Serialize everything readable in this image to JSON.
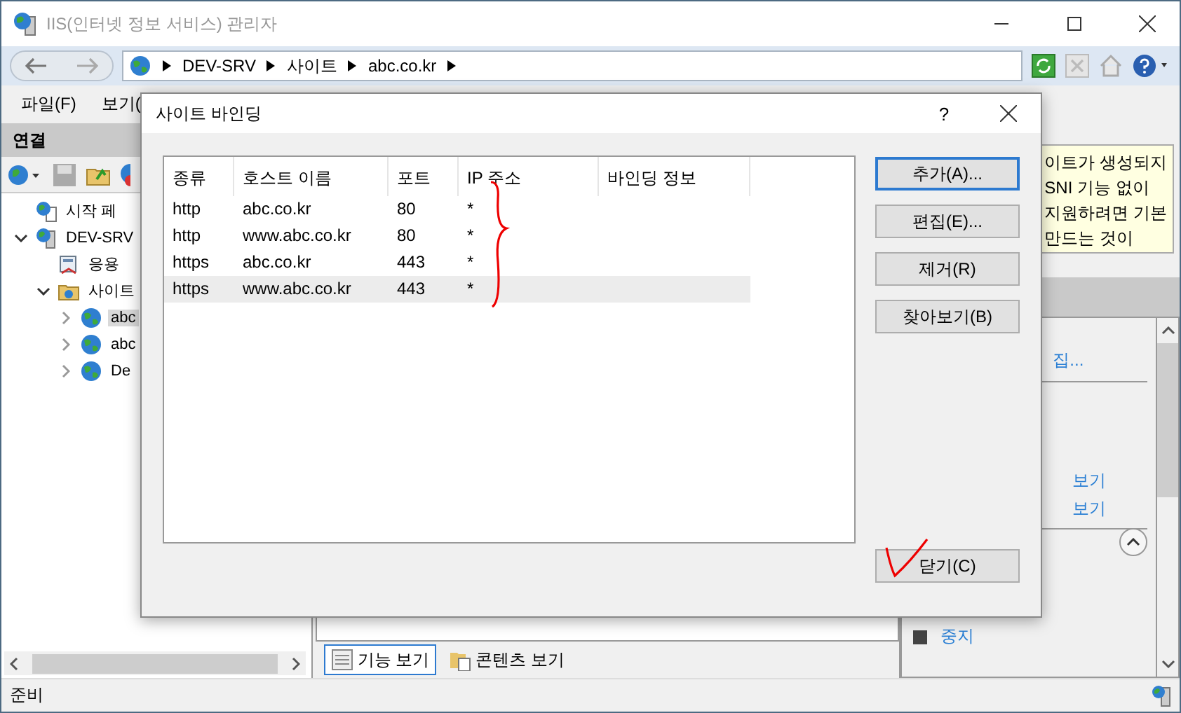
{
  "window": {
    "title": "IIS(인터넷 정보 서비스) 관리자"
  },
  "address_bar": {
    "crumbs": [
      "DEV-SRV",
      "사이트",
      "abc.co.kr"
    ]
  },
  "menu": [
    "파일(F)",
    "보기("
  ],
  "connections": {
    "title": "연결",
    "tree": [
      {
        "label": "시작 페",
        "kind": "page",
        "selected": false
      },
      {
        "label": "DEV-SRV",
        "kind": "server",
        "selected": false,
        "expanded": true,
        "children": [
          {
            "label": "응용",
            "kind": "pool",
            "selected": false
          },
          {
            "label": "사이트",
            "kind": "sites",
            "selected": false,
            "expanded": true,
            "children": [
              {
                "label": "abc",
                "kind": "site",
                "selected": true,
                "expanded": false
              },
              {
                "label": "abc",
                "kind": "site",
                "selected": false,
                "expanded": false
              },
              {
                "label": "De",
                "kind": "site",
                "selected": false,
                "expanded": false
              }
            ]
          }
        ]
      }
    ]
  },
  "views": [
    {
      "label": "기능 보기",
      "selected": true
    },
    {
      "label": "콘텐츠 보기",
      "selected": false
    }
  ],
  "alert": {
    "lines": [
      "이트가 생성되지",
      "SNI 기능 없이",
      "지원하려면 기본",
      "만드는 것이"
    ]
  },
  "actions": {
    "links_top": [
      "집..."
    ],
    "links_mid": [
      "보기",
      "보기"
    ],
    "links_bottom": [
      {
        "label": "중지",
        "kind": "stop"
      }
    ]
  },
  "status_bar": "준비",
  "dialog": {
    "title": "사이트 바인딩",
    "help": "?",
    "columns": [
      "종류",
      "호스트 이름",
      "포트",
      "IP 주소",
      "바인딩 정보"
    ],
    "rows": [
      {
        "cells": [
          "http",
          "abc.co.kr",
          "80",
          "*"
        ],
        "selected": false
      },
      {
        "cells": [
          "http",
          "www.abc.co.kr",
          "80",
          "*"
        ],
        "selected": false
      },
      {
        "cells": [
          "https",
          "abc.co.kr",
          "443",
          "*"
        ],
        "selected": false
      },
      {
        "cells": [
          "https",
          "www.abc.co.kr",
          "443",
          "*"
        ],
        "selected": true
      }
    ],
    "buttons": [
      {
        "label": "추가(A)...",
        "default": true
      },
      {
        "label": "편집(E)...",
        "default": false
      },
      {
        "label": "제거(R)",
        "default": false
      },
      {
        "label": "찾아보기(B)",
        "default": false
      }
    ],
    "close_button": "닫기(C)"
  }
}
